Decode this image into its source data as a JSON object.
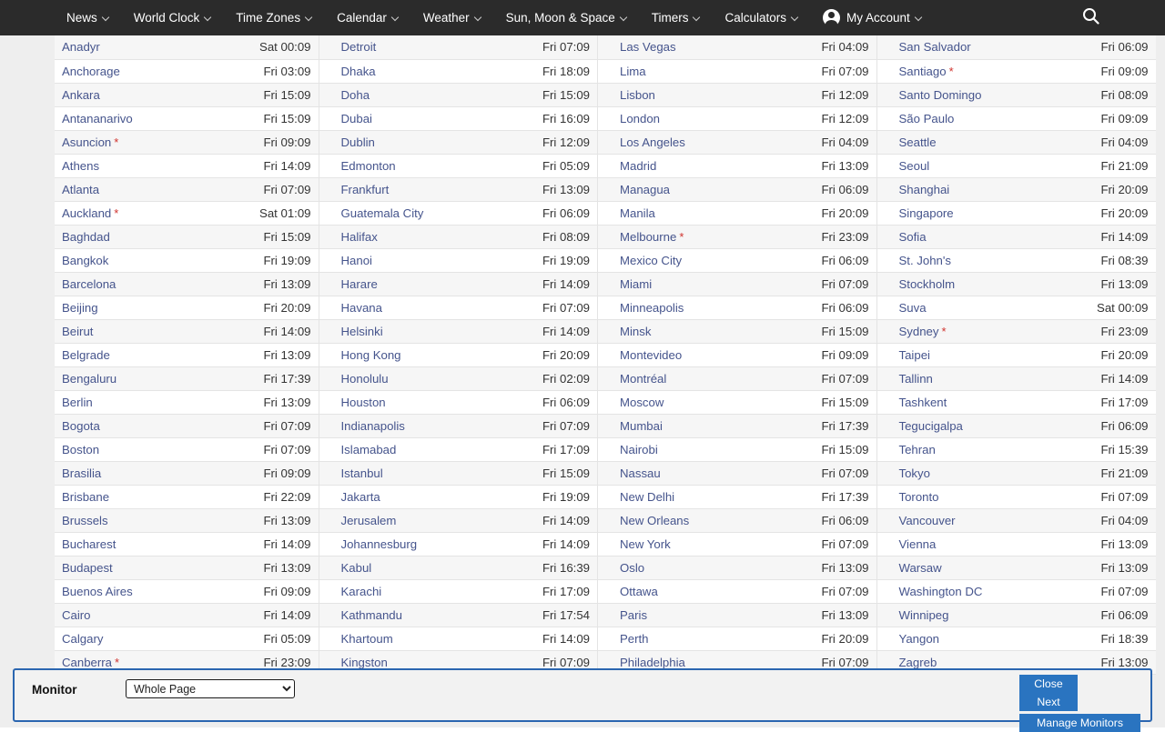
{
  "nav": {
    "items": [
      {
        "label": "News",
        "caret": true
      },
      {
        "label": "World Clock",
        "caret": true
      },
      {
        "label": "Time Zones",
        "caret": true
      },
      {
        "label": "Calendar",
        "caret": true
      },
      {
        "label": "Weather",
        "caret": true
      },
      {
        "label": "Sun, Moon & Space",
        "caret": true
      },
      {
        "label": "Timers",
        "caret": true
      },
      {
        "label": "Calculators",
        "caret": true
      },
      {
        "label": "My Account",
        "caret": true,
        "avatar": true
      }
    ],
    "search_icon": "search-icon",
    "background": "#2b2b2b",
    "text_color": "#ffffff"
  },
  "clock_table": {
    "columns": 4,
    "dst_marker": "*",
    "dst_marker_color": "#d0332e",
    "city_link_color": "#45548c",
    "rows": [
      [
        {
          "city": "Anadyr",
          "dst": false,
          "time": "Sat 00:09"
        },
        {
          "city": "Detroit",
          "dst": false,
          "time": "Fri 07:09"
        },
        {
          "city": "Las Vegas",
          "dst": false,
          "time": "Fri 04:09"
        },
        {
          "city": "San Salvador",
          "dst": false,
          "time": "Fri 06:09"
        }
      ],
      [
        {
          "city": "Anchorage",
          "dst": false,
          "time": "Fri 03:09"
        },
        {
          "city": "Dhaka",
          "dst": false,
          "time": "Fri 18:09"
        },
        {
          "city": "Lima",
          "dst": false,
          "time": "Fri 07:09"
        },
        {
          "city": "Santiago",
          "dst": true,
          "time": "Fri 09:09"
        }
      ],
      [
        {
          "city": "Ankara",
          "dst": false,
          "time": "Fri 15:09"
        },
        {
          "city": "Doha",
          "dst": false,
          "time": "Fri 15:09"
        },
        {
          "city": "Lisbon",
          "dst": false,
          "time": "Fri 12:09"
        },
        {
          "city": "Santo Domingo",
          "dst": false,
          "time": "Fri 08:09"
        }
      ],
      [
        {
          "city": "Antananarivo",
          "dst": false,
          "time": "Fri 15:09"
        },
        {
          "city": "Dubai",
          "dst": false,
          "time": "Fri 16:09"
        },
        {
          "city": "London",
          "dst": false,
          "time": "Fri 12:09"
        },
        {
          "city": "São Paulo",
          "dst": false,
          "time": "Fri 09:09"
        }
      ],
      [
        {
          "city": "Asuncion",
          "dst": true,
          "time": "Fri 09:09"
        },
        {
          "city": "Dublin",
          "dst": false,
          "time": "Fri 12:09"
        },
        {
          "city": "Los Angeles",
          "dst": false,
          "time": "Fri 04:09"
        },
        {
          "city": "Seattle",
          "dst": false,
          "time": "Fri 04:09"
        }
      ],
      [
        {
          "city": "Athens",
          "dst": false,
          "time": "Fri 14:09"
        },
        {
          "city": "Edmonton",
          "dst": false,
          "time": "Fri 05:09"
        },
        {
          "city": "Madrid",
          "dst": false,
          "time": "Fri 13:09"
        },
        {
          "city": "Seoul",
          "dst": false,
          "time": "Fri 21:09"
        }
      ],
      [
        {
          "city": "Atlanta",
          "dst": false,
          "time": "Fri 07:09"
        },
        {
          "city": "Frankfurt",
          "dst": false,
          "time": "Fri 13:09"
        },
        {
          "city": "Managua",
          "dst": false,
          "time": "Fri 06:09"
        },
        {
          "city": "Shanghai",
          "dst": false,
          "time": "Fri 20:09"
        }
      ],
      [
        {
          "city": "Auckland",
          "dst": true,
          "time": "Sat 01:09"
        },
        {
          "city": "Guatemala City",
          "dst": false,
          "time": "Fri 06:09"
        },
        {
          "city": "Manila",
          "dst": false,
          "time": "Fri 20:09"
        },
        {
          "city": "Singapore",
          "dst": false,
          "time": "Fri 20:09"
        }
      ],
      [
        {
          "city": "Baghdad",
          "dst": false,
          "time": "Fri 15:09"
        },
        {
          "city": "Halifax",
          "dst": false,
          "time": "Fri 08:09"
        },
        {
          "city": "Melbourne",
          "dst": true,
          "time": "Fri 23:09"
        },
        {
          "city": "Sofia",
          "dst": false,
          "time": "Fri 14:09"
        }
      ],
      [
        {
          "city": "Bangkok",
          "dst": false,
          "time": "Fri 19:09"
        },
        {
          "city": "Hanoi",
          "dst": false,
          "time": "Fri 19:09"
        },
        {
          "city": "Mexico City",
          "dst": false,
          "time": "Fri 06:09"
        },
        {
          "city": "St. John's",
          "dst": false,
          "time": "Fri 08:39"
        }
      ],
      [
        {
          "city": "Barcelona",
          "dst": false,
          "time": "Fri 13:09"
        },
        {
          "city": "Harare",
          "dst": false,
          "time": "Fri 14:09"
        },
        {
          "city": "Miami",
          "dst": false,
          "time": "Fri 07:09"
        },
        {
          "city": "Stockholm",
          "dst": false,
          "time": "Fri 13:09"
        }
      ],
      [
        {
          "city": "Beijing",
          "dst": false,
          "time": "Fri 20:09"
        },
        {
          "city": "Havana",
          "dst": false,
          "time": "Fri 07:09"
        },
        {
          "city": "Minneapolis",
          "dst": false,
          "time": "Fri 06:09"
        },
        {
          "city": "Suva",
          "dst": false,
          "time": "Sat 00:09"
        }
      ],
      [
        {
          "city": "Beirut",
          "dst": false,
          "time": "Fri 14:09"
        },
        {
          "city": "Helsinki",
          "dst": false,
          "time": "Fri 14:09"
        },
        {
          "city": "Minsk",
          "dst": false,
          "time": "Fri 15:09"
        },
        {
          "city": "Sydney",
          "dst": true,
          "time": "Fri 23:09"
        }
      ],
      [
        {
          "city": "Belgrade",
          "dst": false,
          "time": "Fri 13:09"
        },
        {
          "city": "Hong Kong",
          "dst": false,
          "time": "Fri 20:09"
        },
        {
          "city": "Montevideo",
          "dst": false,
          "time": "Fri 09:09"
        },
        {
          "city": "Taipei",
          "dst": false,
          "time": "Fri 20:09"
        }
      ],
      [
        {
          "city": "Bengaluru",
          "dst": false,
          "time": "Fri 17:39"
        },
        {
          "city": "Honolulu",
          "dst": false,
          "time": "Fri 02:09"
        },
        {
          "city": "Montréal",
          "dst": false,
          "time": "Fri 07:09"
        },
        {
          "city": "Tallinn",
          "dst": false,
          "time": "Fri 14:09"
        }
      ],
      [
        {
          "city": "Berlin",
          "dst": false,
          "time": "Fri 13:09"
        },
        {
          "city": "Houston",
          "dst": false,
          "time": "Fri 06:09"
        },
        {
          "city": "Moscow",
          "dst": false,
          "time": "Fri 15:09"
        },
        {
          "city": "Tashkent",
          "dst": false,
          "time": "Fri 17:09"
        }
      ],
      [
        {
          "city": "Bogota",
          "dst": false,
          "time": "Fri 07:09"
        },
        {
          "city": "Indianapolis",
          "dst": false,
          "time": "Fri 07:09"
        },
        {
          "city": "Mumbai",
          "dst": false,
          "time": "Fri 17:39"
        },
        {
          "city": "Tegucigalpa",
          "dst": false,
          "time": "Fri 06:09"
        }
      ],
      [
        {
          "city": "Boston",
          "dst": false,
          "time": "Fri 07:09"
        },
        {
          "city": "Islamabad",
          "dst": false,
          "time": "Fri 17:09"
        },
        {
          "city": "Nairobi",
          "dst": false,
          "time": "Fri 15:09"
        },
        {
          "city": "Tehran",
          "dst": false,
          "time": "Fri 15:39"
        }
      ],
      [
        {
          "city": "Brasilia",
          "dst": false,
          "time": "Fri 09:09"
        },
        {
          "city": "Istanbul",
          "dst": false,
          "time": "Fri 15:09"
        },
        {
          "city": "Nassau",
          "dst": false,
          "time": "Fri 07:09"
        },
        {
          "city": "Tokyo",
          "dst": false,
          "time": "Fri 21:09"
        }
      ],
      [
        {
          "city": "Brisbane",
          "dst": false,
          "time": "Fri 22:09"
        },
        {
          "city": "Jakarta",
          "dst": false,
          "time": "Fri 19:09"
        },
        {
          "city": "New Delhi",
          "dst": false,
          "time": "Fri 17:39"
        },
        {
          "city": "Toronto",
          "dst": false,
          "time": "Fri 07:09"
        }
      ],
      [
        {
          "city": "Brussels",
          "dst": false,
          "time": "Fri 13:09"
        },
        {
          "city": "Jerusalem",
          "dst": false,
          "time": "Fri 14:09"
        },
        {
          "city": "New Orleans",
          "dst": false,
          "time": "Fri 06:09"
        },
        {
          "city": "Vancouver",
          "dst": false,
          "time": "Fri 04:09"
        }
      ],
      [
        {
          "city": "Bucharest",
          "dst": false,
          "time": "Fri 14:09"
        },
        {
          "city": "Johannesburg",
          "dst": false,
          "time": "Fri 14:09"
        },
        {
          "city": "New York",
          "dst": false,
          "time": "Fri 07:09"
        },
        {
          "city": "Vienna",
          "dst": false,
          "time": "Fri 13:09"
        }
      ],
      [
        {
          "city": "Budapest",
          "dst": false,
          "time": "Fri 13:09"
        },
        {
          "city": "Kabul",
          "dst": false,
          "time": "Fri 16:39"
        },
        {
          "city": "Oslo",
          "dst": false,
          "time": "Fri 13:09"
        },
        {
          "city": "Warsaw",
          "dst": false,
          "time": "Fri 13:09"
        }
      ],
      [
        {
          "city": "Buenos Aires",
          "dst": false,
          "time": "Fri 09:09"
        },
        {
          "city": "Karachi",
          "dst": false,
          "time": "Fri 17:09"
        },
        {
          "city": "Ottawa",
          "dst": false,
          "time": "Fri 07:09"
        },
        {
          "city": "Washington DC",
          "dst": false,
          "time": "Fri 07:09"
        }
      ],
      [
        {
          "city": "Cairo",
          "dst": false,
          "time": "Fri 14:09"
        },
        {
          "city": "Kathmandu",
          "dst": false,
          "time": "Fri 17:54"
        },
        {
          "city": "Paris",
          "dst": false,
          "time": "Fri 13:09"
        },
        {
          "city": "Winnipeg",
          "dst": false,
          "time": "Fri 06:09"
        }
      ],
      [
        {
          "city": "Calgary",
          "dst": false,
          "time": "Fri 05:09"
        },
        {
          "city": "Khartoum",
          "dst": false,
          "time": "Fri 14:09"
        },
        {
          "city": "Perth",
          "dst": false,
          "time": "Fri 20:09"
        },
        {
          "city": "Yangon",
          "dst": false,
          "time": "Fri 18:39"
        }
      ],
      [
        {
          "city": "Canberra",
          "dst": true,
          "time": "Fri 23:09"
        },
        {
          "city": "Kingston",
          "dst": false,
          "time": "Fri 07:09"
        },
        {
          "city": "Philadelphia",
          "dst": false,
          "time": "Fri 07:09"
        },
        {
          "city": "Zagreb",
          "dst": false,
          "time": "Fri 13:09"
        }
      ]
    ]
  },
  "monitor_bar": {
    "label": "Monitor",
    "select_value": "Whole Page",
    "select_options": [
      "Whole Page"
    ],
    "buttons": {
      "close": "Close",
      "next": "Next",
      "manage": "Manage Monitors"
    },
    "accent_color": "#2a74c0",
    "border_color": "#2b66b0"
  }
}
